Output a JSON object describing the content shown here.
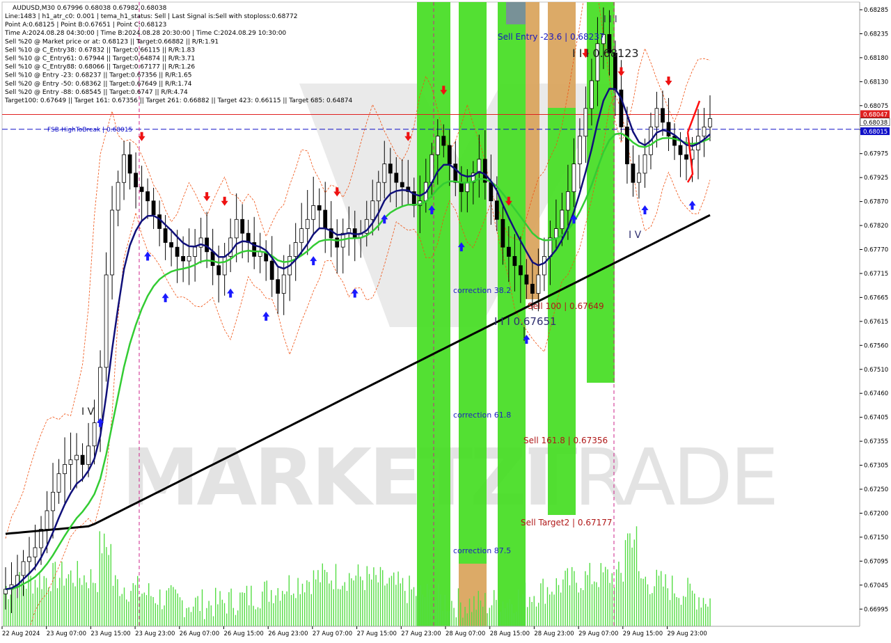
{
  "chart_data": {
    "type": "candlestick",
    "symbol_line": "AUDUSD,M30  0.67996 0.68038 0.67982 0.68038",
    "info_lines": [
      "Line:1483  |  h1_atr_c0: 0.001  |  tema_h1_status: Sell  |  Last Signal is:Sell with stoploss:0.68772",
      "Point A:0.68125  |  Point B:0.67651  |  Point C:0.68123",
      "Time A:2024.08.28 04:30:00  |  Time B:2024.08.28 20:30:00  |  Time C:2024.08.29 10:30:00",
      "Sell %20 @ Market price or at: 0.68123  ||  Target:0.66882  ||  R/R:1.91",
      "Sell %10 @ C_Entry38: 0.67832  ||  Target:0.66115  ||  R/R:1.83",
      "Sell %10 @ C_Entry61: 0.67944  ||  Target:0.64874  ||  R/R:3.71",
      "Sell %10 @ C_Entry88: 0.68066  ||  Target:0.67177  ||  R/R:1.26",
      "Sell %10 @ Entry -23: 0.68237  ||  Target:0.67356  ||  R/R:1.65",
      "Sell %20 @ Entry -50: 0.68362  ||  Target:0.67649  ||  R/R:1.74",
      "Sell %20 @ Entry -88: 0.68545  ||  Target:0.6747  ||  R/R:4.74",
      "Target100: 0.67649  ||  Target 161: 0.67356  ||  Target 261: 0.66882  ||  Target 423: 0.66115  ||  Target 685: 0.64874"
    ],
    "y_ticks": [
      "0.68285",
      "0.68235",
      "0.68180",
      "0.68130",
      "0.68075",
      "0.68025",
      "0.67975",
      "0.67925",
      "0.67870",
      "0.67820",
      "0.67770",
      "0.67715",
      "0.67665",
      "0.67615",
      "0.67560",
      "0.67510",
      "0.67460",
      "0.67405",
      "0.67355",
      "0.67305",
      "0.67250",
      "0.67200",
      "0.67150",
      "0.67095",
      "0.67045",
      "0.66995",
      "0.66945"
    ],
    "y_range": [
      0.6694,
      0.6829
    ],
    "x_ticks": [
      "22 Aug 2024",
      "23 Aug 07:00",
      "23 Aug 15:00",
      "23 Aug 23:00",
      "26 Aug 07:00",
      "26 Aug 15:00",
      "26 Aug 23:00",
      "27 Aug 07:00",
      "27 Aug 15:00",
      "27 Aug 23:00",
      "28 Aug 07:00",
      "28 Aug 15:00",
      "28 Aug 23:00",
      "29 Aug 07:00",
      "29 Aug 15:00",
      "29 Aug 23:00"
    ],
    "price_labels": {
      "red_line": "0.68047",
      "current": "0.68038",
      "blue_line": "0.68015"
    },
    "levels": [
      {
        "label": "FSB-HighToBreak | 0.68015",
        "value": 0.68015,
        "color": "#1010c8"
      },
      {
        "label": "Sell Entry -23.6 | 0.68237",
        "value": 0.68237,
        "color": "#1818c0"
      },
      {
        "label": "Sell 100 | 0.67649",
        "value": 0.67649,
        "color": "#b01818"
      },
      {
        "label": "Sell 161.8 | 0.67356",
        "value": 0.67356,
        "color": "#b01818"
      },
      {
        "label": "Sell Target2 | 0.67177",
        "value": 0.67177,
        "color": "#b01818"
      }
    ],
    "corrections": [
      {
        "label": "correction 38.2",
        "value": 0.67685
      },
      {
        "label": "correction 61.8",
        "value": 0.67405
      },
      {
        "label": "correction 87.5",
        "value": 0.6711
      }
    ],
    "wave_labels": [
      {
        "label": "I I I",
        "value": 0.68275
      },
      {
        "label": "I I I 0.68123",
        "value": 0.68125
      },
      {
        "label": "I I I 0.67651",
        "value": 0.67605
      },
      {
        "label": "I V",
        "value": 0.67395
      },
      {
        "label": "I V",
        "value": 0.6777
      }
    ],
    "close_series": [
      0.6702,
      0.6703,
      0.6705,
      0.6708,
      0.6709,
      0.6711,
      0.6715,
      0.6719,
      0.6723,
      0.6727,
      0.6729,
      0.673,
      0.6731,
      0.6729,
      0.6733,
      0.6738,
      0.675,
      0.677,
      0.6784,
      0.679,
      0.6796,
      0.6792,
      0.6789,
      0.6788,
      0.6786,
      0.6783,
      0.678,
      0.6777,
      0.6776,
      0.6774,
      0.6773,
      0.6774,
      0.6776,
      0.6778,
      0.6775,
      0.6772,
      0.677,
      0.6774,
      0.6778,
      0.6782,
      0.6779,
      0.6777,
      0.6774,
      0.6775,
      0.6773,
      0.6769,
      0.6766,
      0.677,
      0.6774,
      0.6777,
      0.678,
      0.6782,
      0.6785,
      0.6784,
      0.678,
      0.6778,
      0.6776,
      0.6779,
      0.678,
      0.6778,
      0.6779,
      0.6782,
      0.6786,
      0.679,
      0.6794,
      0.6792,
      0.679,
      0.6789,
      0.6788,
      0.6785,
      0.6786,
      0.679,
      0.6796,
      0.68,
      0.6798,
      0.6794,
      0.679,
      0.6788,
      0.679,
      0.6792,
      0.6795,
      0.679,
      0.6786,
      0.6782,
      0.6776,
      0.6774,
      0.6772,
      0.677,
      0.6768,
      0.6766,
      0.677,
      0.6774,
      0.6778,
      0.678,
      0.6784,
      0.6788,
      0.6794,
      0.68,
      0.6806,
      0.6812,
      0.682,
      0.6822,
      0.6818,
      0.681,
      0.6802,
      0.6794,
      0.679,
      0.6792,
      0.6796,
      0.6802,
      0.6806,
      0.6803,
      0.68,
      0.6798,
      0.6796,
      0.6795,
      0.6797,
      0.68,
      0.6802,
      0.68038
    ],
    "ma_fast_end": 0.68015,
    "ma_mid_end": 0.68,
    "ma_slow_end": 0.6783,
    "grid": false,
    "watermark": "MARKETZI TRADE"
  }
}
